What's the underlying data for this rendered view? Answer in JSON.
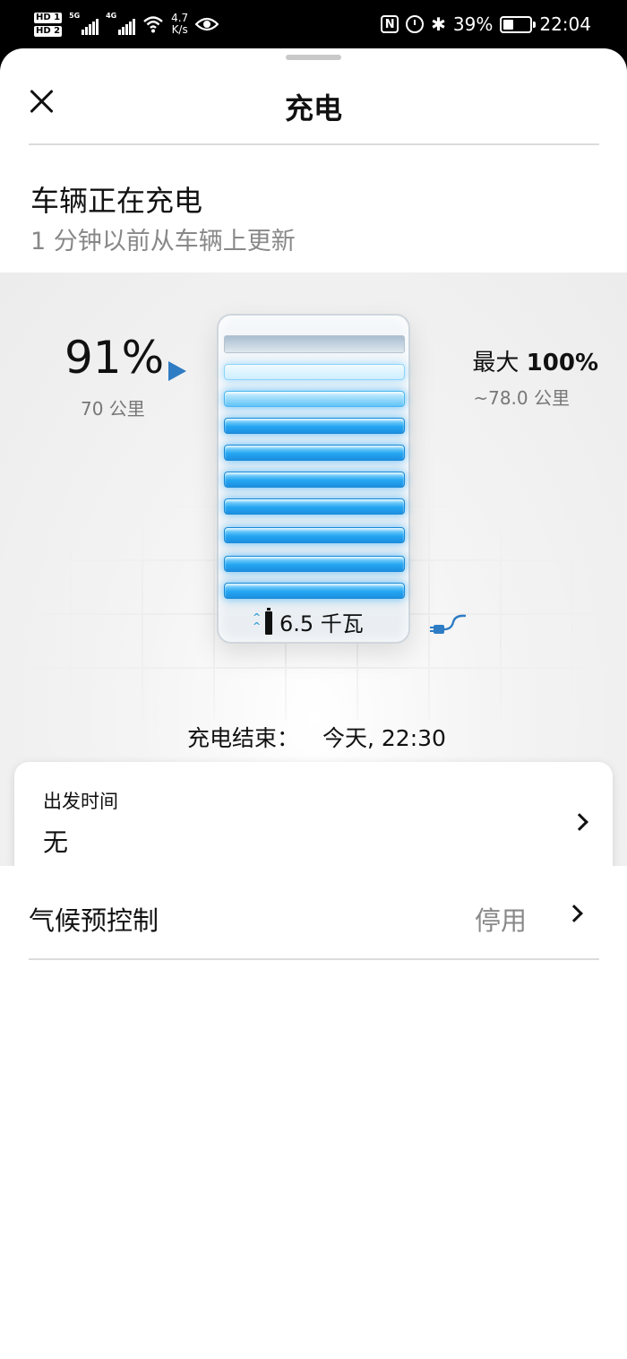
{
  "status_bar": {
    "hd1": "HD 1",
    "hd2": "HD 2",
    "sim1_type": "5G",
    "sim2_type": "4G",
    "speed_value": "4.7",
    "speed_unit": "K/s",
    "nfc": "N",
    "battery_pct": "39%",
    "battery_level": 0.39,
    "time": "22:04"
  },
  "header": {
    "title": "充电"
  },
  "charging_status": {
    "title": "车辆正在充电",
    "subtitle": "1 分钟以前从车辆上更新"
  },
  "battery": {
    "percent": "91%",
    "range": "70 公里",
    "max_label": "最大",
    "max_value": "100%",
    "max_range": "~78.0 公里",
    "power": "6.5 千瓦",
    "charge_level": 0.91
  },
  "charge_end": {
    "label": "充电结束：",
    "value": "今天, 22:30"
  },
  "departure": {
    "label": "出发时间",
    "value": "无"
  },
  "climate": {
    "label": "气候预控制",
    "status": "停用"
  },
  "colors": {
    "accent": "#2e7cc4",
    "bar_blue": "#25a6f2"
  }
}
